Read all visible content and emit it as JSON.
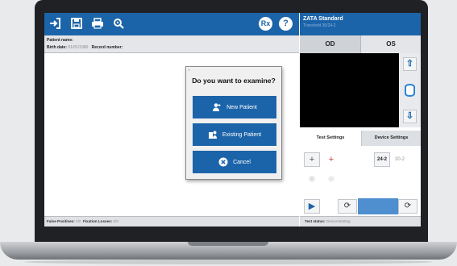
{
  "toolbar": {
    "icons": [
      "sign-in-icon",
      "save-icon",
      "print-icon",
      "settings-icon",
      "rx-icon",
      "help-icon"
    ],
    "rx_label": "Rx",
    "help_label": "?"
  },
  "patient": {
    "name_label": "Patient name:",
    "birth_label": "Birth date:",
    "birth_value": "01/01/1980",
    "record_label": "Record number:"
  },
  "dialog": {
    "question": "Do you want to examine?",
    "new_patient": "New Patient",
    "existing_patient": "Existing Patient",
    "cancel": "Cancel"
  },
  "status": {
    "fp_label": "False Positives:",
    "fp_value": "0/0",
    "fl_label": "Fixation Losses:",
    "fl_value": "0/0",
    "test_label": "Test status:",
    "test_value": "Demonstrating"
  },
  "right_panel": {
    "title": "ZATA Standard",
    "subtitle": "Threshold 30/24-2",
    "eye_tabs": [
      "OD",
      "OS"
    ],
    "settings_tabs": [
      "Test Settings",
      "Device Settings"
    ],
    "pattern_selected": "24-2",
    "pattern_other": "30-2",
    "progress_fraction": 0.0
  },
  "colors": {
    "primary": "#1c64a9",
    "fixation_cross": "#d9362b",
    "eye_view": "#000000"
  }
}
